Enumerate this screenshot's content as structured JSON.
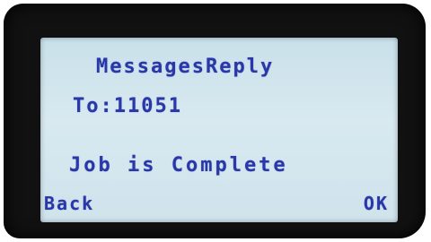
{
  "screen": {
    "title": "MessagesReply",
    "recipient": "To:11051",
    "message": "Job is Complete"
  },
  "softkeys": {
    "left_label": "Back",
    "right_label": "OK"
  },
  "colors": {
    "lcd_background": "#d2e6ee",
    "lcd_text": "#2a37a8",
    "bezel": "#111111"
  }
}
